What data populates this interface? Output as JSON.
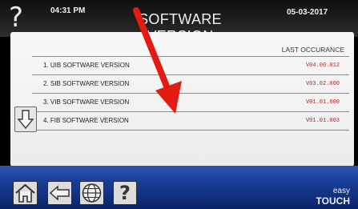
{
  "header": {
    "help_symbol": "?",
    "time": "04:31 PM",
    "title": "SOFTWARE VERSION",
    "date": "05-03-2017"
  },
  "table": {
    "column_header": "LAST OCCURANCE",
    "rows": [
      {
        "label": "1.  UIB SOFTWARE VERSION",
        "value": "V04.00.012"
      },
      {
        "label": "2.  SIB SOFTWARE VERSION",
        "value": "V03.02.000"
      },
      {
        "label": "3.  VIB SOFTWARE VERSION",
        "value": "V01.01.000"
      },
      {
        "label": "4.  FIB SOFTWARE VERSION",
        "value": "V01.01.003"
      }
    ]
  },
  "footer": {
    "buttons": [
      {
        "icon": "home-icon"
      },
      {
        "icon": "back-arrow-icon"
      },
      {
        "icon": "globe-icon"
      },
      {
        "icon": "help-icon",
        "label": "?"
      }
    ],
    "brand_top": "easy",
    "brand_bottom": "TOUCH"
  },
  "annotation": {
    "icon": "red-arrow-icon",
    "color": "#e41b13"
  },
  "colors": {
    "footer_blue": "#163a92",
    "version_red": "#b02424"
  }
}
